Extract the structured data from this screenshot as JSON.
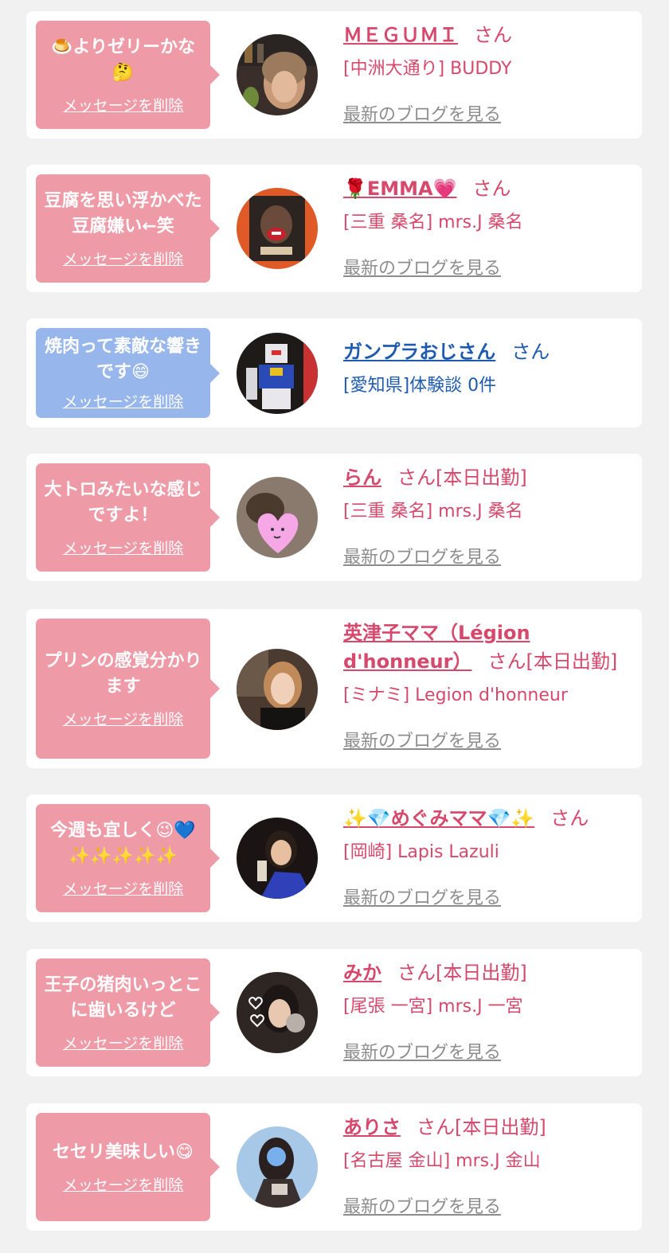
{
  "delete_label": "メッセージを削除",
  "blog_label": "最新のブログを見る",
  "colors": {
    "pink_bubble": "#ef9aa7",
    "blue_bubble": "#97b6ec",
    "name_pink": "#d6486c",
    "name_blue": "#1d5ab0"
  },
  "messages": [
    {
      "text": "🍮よりゼリーかな🤔",
      "name": "ＭＥＧＵＭＩ",
      "suffix": "さん",
      "shop": "[中洲大通り] BUDDY",
      "blog": true,
      "theme": "pink",
      "avatar_icon": "woman-photo-icon"
    },
    {
      "text": "豆腐を思い浮かべた豆腐嫌い←笑",
      "name": "🌹EMMA💗",
      "suffix": "さん",
      "shop": "[三重 桑名] mrs.J 桑名",
      "blog": true,
      "theme": "pink",
      "avatar_icon": "face-photo-icon"
    },
    {
      "text": "焼肉って素敵な響きです😄",
      "name": "ガンプラおじさん",
      "suffix": "さん",
      "shop": "[愛知県]体験談 0件",
      "blog": false,
      "theme": "blue",
      "avatar_icon": "robot-model-icon"
    },
    {
      "text": "大トロみたいな感じですよ！",
      "name": "らん",
      "suffix": "さん[本日出勤]",
      "shop": "[三重 桑名] mrs.J 桑名",
      "blog": true,
      "theme": "pink",
      "avatar_icon": "heart-face-icon"
    },
    {
      "text": "プリンの感覚分かります",
      "name": "英津子ママ（Légion d'honneur）",
      "suffix": "さん[本日出勤]",
      "shop": "[ミナミ] Legion d'honneur",
      "blog": true,
      "theme": "pink",
      "avatar_icon": "woman-photo-icon"
    },
    {
      "text": "今週も宜しく😉💙✨✨✨✨✨",
      "name": "✨💎めぐみママ💎✨",
      "suffix": "さん",
      "shop": "[岡崎] Lapis Lazuli",
      "blog": true,
      "theme": "pink",
      "avatar_icon": "woman-photo-icon"
    },
    {
      "text": "王子の猪肉いっとこに歯いるけど",
      "name": "みか",
      "suffix": "さん[本日出勤]",
      "shop": "[尾張 一宮] mrs.J 一宮",
      "blog": true,
      "theme": "pink",
      "avatar_icon": "woman-photo-icon"
    },
    {
      "text": "セセリ美味しい😋",
      "name": "ありさ",
      "suffix": "さん[本日出勤]",
      "shop": "[名古屋 金山] mrs.J 金山",
      "blog": true,
      "theme": "pink",
      "avatar_icon": "blue-face-icon"
    }
  ]
}
